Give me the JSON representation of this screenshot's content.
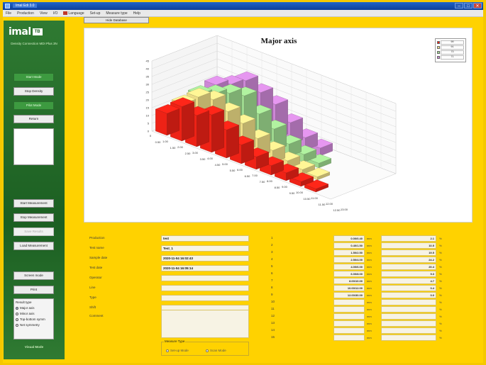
{
  "window": {
    "title": "Imal Edi 3.0",
    "controls": [
      "–",
      "□",
      "✕"
    ]
  },
  "menu": [
    "File",
    "Production",
    "View",
    "I/O",
    "Language",
    "Set-up",
    "Measure type",
    "Help"
  ],
  "sidebar": {
    "brand": "imal",
    "brand_mark": "TB",
    "subtitle": "Density Connection MDI Plus 3N",
    "buttons_top": [
      {
        "label": "Start Mode",
        "style": "green"
      },
      {
        "label": "Stop Density",
        "style": "normal"
      },
      {
        "label": "Pilot Mode",
        "style": "green"
      },
      {
        "label": "Return",
        "style": "normal"
      }
    ],
    "buttons_bottom": [
      {
        "label": "Start Measurement",
        "style": "normal"
      },
      {
        "label": "Stop Measurement",
        "style": "normal"
      },
      {
        "label": "Save Results",
        "style": "disabled"
      },
      {
        "label": "Load Measurement",
        "style": "normal"
      },
      {
        "label": "Screen mode",
        "style": "normal"
      },
      {
        "label": "Print",
        "style": "normal"
      }
    ],
    "result_type": {
      "label": "Result type",
      "options": [
        {
          "label": "Major axis",
          "selected": true
        },
        {
          "label": "Minor axis",
          "selected": false
        },
        {
          "label": "Top-bottom symm",
          "selected": false
        },
        {
          "label": "Net symmetry",
          "selected": false
        }
      ]
    },
    "mode_label": "Visual Mode"
  },
  "toolbar": {
    "hide_database": "Hide Database"
  },
  "chart_data": {
    "type": "bar3d",
    "title": "Major axis",
    "z_ticks": [
      "0",
      "5",
      "10",
      "15",
      "20",
      "25",
      "30",
      "35",
      "40",
      "45"
    ],
    "x_ticks": [
      "0",
      "0.50",
      "1.00",
      "1.50",
      "2.00",
      "2.50",
      "3.00",
      "3.50",
      "4.00",
      "4.50",
      "5.00",
      "5.50",
      "6.00",
      "6.50",
      "7.00",
      "7.50",
      "8.00",
      "8.50",
      "9.00",
      "9.50",
      "10.00",
      "10.50",
      "11.00",
      "11.50",
      "12.00",
      "12.50",
      "13.00"
    ],
    "series": [
      {
        "color": "#ee2216",
        "values": [
          14,
          22,
          20,
          24,
          18,
          12,
          8,
          6,
          5,
          3,
          2
        ]
      },
      {
        "color": "#ecdc86",
        "values": [
          16,
          24,
          26,
          22,
          18,
          12,
          8,
          5,
          3,
          2
        ]
      },
      {
        "color": "#9ed98f",
        "values": [
          18,
          22,
          26,
          28,
          20,
          14,
          8,
          5,
          3
        ]
      },
      {
        "color": "#cd87d6",
        "values": [
          20,
          24,
          30,
          26,
          22,
          14,
          8,
          5
        ]
      }
    ],
    "legend": [
      {
        "color": "#ee2216",
        "value": "99"
      },
      {
        "color": "#ecdc86",
        "value": "91"
      },
      {
        "color": "#9ed98f",
        "value": "73"
      },
      {
        "color": "#cd87d6",
        "value": "71"
      }
    ]
  },
  "form": {
    "fields": [
      {
        "label": "Production",
        "value": "test"
      },
      {
        "label": "Test name",
        "value": "Test_1"
      },
      {
        "label": "Sample date",
        "value": "2020-11-04 16:02:43"
      },
      {
        "label": "Test date",
        "value": "2020-11-04 16:05:14"
      },
      {
        "label": "Operator",
        "value": ""
      },
      {
        "label": "Line",
        "value": ""
      },
      {
        "label": "Type",
        "value": ""
      },
      {
        "label": "Shift",
        "value": ""
      }
    ],
    "comment_label": "Comment",
    "measure_type": {
      "label": "Measure Type",
      "options": [
        "Set-up Mode",
        "Scan Mode"
      ]
    }
  },
  "ranges": {
    "unit1": "mm",
    "unit2": "%",
    "rows": [
      {
        "n": "1",
        "range": "0.00/0.40",
        "value": "2.1"
      },
      {
        "n": "2",
        "range": "0.40/1.50",
        "value": "10.5"
      },
      {
        "n": "3",
        "range": "1.50/2.50",
        "value": "19.5"
      },
      {
        "n": "4",
        "range": "2.50/4.00",
        "value": "24.2"
      },
      {
        "n": "5",
        "range": "4.00/6.00",
        "value": "20.4"
      },
      {
        "n": "6",
        "range": "6.00/8.00",
        "value": "9.3"
      },
      {
        "n": "7",
        "range": "8.00/10.00",
        "value": "4.7"
      },
      {
        "n": "8",
        "range": "10.00/12.00",
        "value": "0.4"
      },
      {
        "n": "9",
        "range": "12.00/30.00",
        "value": "0.0"
      },
      {
        "n": "10",
        "range": "",
        "value": ""
      },
      {
        "n": "11",
        "range": "",
        "value": ""
      },
      {
        "n": "12",
        "range": "",
        "value": ""
      },
      {
        "n": "13",
        "range": "",
        "value": ""
      },
      {
        "n": "14",
        "range": "",
        "value": ""
      },
      {
        "n": "15",
        "range": "",
        "value": ""
      }
    ]
  }
}
